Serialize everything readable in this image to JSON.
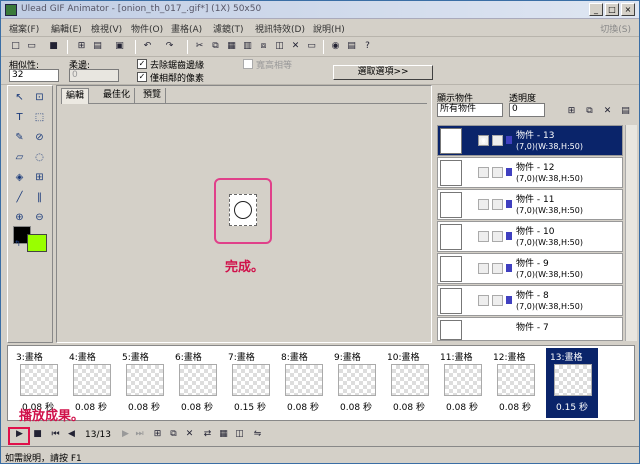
{
  "window": {
    "title": "Ulead GIF Animator - [onion_th_017_.gif*] (1X) 50x50"
  },
  "menu": [
    "檔案(F)",
    "編輯(E)",
    "檢視(V)",
    "物件(O)",
    "畫格(A)",
    "濾鏡(T)",
    "視訊特效(D)",
    "說明(H)"
  ],
  "menu_right": "切換(S)",
  "options": {
    "similarity_label": "相似性:",
    "similarity_value": "32",
    "feather_label": "柔邊:",
    "feather_value": "0",
    "antialias_label": "去除鋸齒邊緣",
    "adjacent_label": "僅相鄰的像素",
    "same_color_label": "寬高相等",
    "select_options_button": "選取選項>>"
  },
  "canvas_tabs": [
    "編輯",
    "最佳化",
    "預覽"
  ],
  "annotations": {
    "done": "完成。",
    "play_result": "播放成果。"
  },
  "objects_panel": {
    "display_label": "顯示物件",
    "display_value": "所有物件",
    "opacity_label": "透明度",
    "opacity_value": "0",
    "items": [
      {
        "title": "物件 - 13",
        "info": "(7,0)(W:38,H:50)",
        "selected": true
      },
      {
        "title": "物件 - 12",
        "info": "(7,0)(W:38,H:50)",
        "selected": false
      },
      {
        "title": "物件 - 11",
        "info": "(7,0)(W:38,H:50)",
        "selected": false
      },
      {
        "title": "物件 - 10",
        "info": "(7,0)(W:38,H:50)",
        "selected": false
      },
      {
        "title": "物件 - 9",
        "info": "(7,0)(W:38,H:50)",
        "selected": false
      },
      {
        "title": "物件 - 8",
        "info": "(7,0)(W:38,H:50)",
        "selected": false
      },
      {
        "title": "物件 - 7",
        "info": "",
        "selected": false
      }
    ]
  },
  "frames": [
    {
      "label": "3:畫格",
      "time": "0.08 秒"
    },
    {
      "label": "4:畫格",
      "time": "0.08 秒"
    },
    {
      "label": "5:畫格",
      "time": "0.08 秒"
    },
    {
      "label": "6:畫格",
      "time": "0.08 秒"
    },
    {
      "label": "7:畫格",
      "time": "0.15 秒"
    },
    {
      "label": "8:畫格",
      "time": "0.08 秒"
    },
    {
      "label": "9:畫格",
      "time": "0.08 秒"
    },
    {
      "label": "10:畫格",
      "time": "0.08 秒"
    },
    {
      "label": "11:畫格",
      "time": "0.08 秒"
    },
    {
      "label": "12:畫格",
      "time": "0.08 秒"
    },
    {
      "label": "13:畫格",
      "time": "0.15 秒"
    }
  ],
  "selected_frame_index": 10,
  "playbar": {
    "counter": "13/13"
  },
  "status": "如需說明，請按 F1",
  "colors": {
    "foreground": "#000000",
    "background": "#99ff00",
    "selection": "#0a246a",
    "annotation": "#d0104a"
  }
}
